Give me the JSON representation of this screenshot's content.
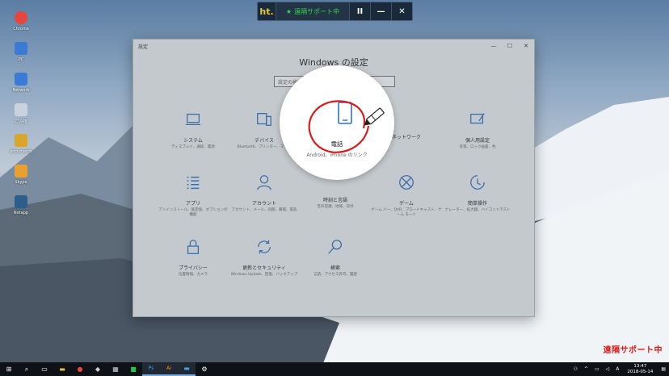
{
  "desktop": {
    "icons": [
      {
        "label": "Chrome",
        "icon": "chrome-icon",
        "color": "#e8453c"
      },
      {
        "label": "PC",
        "icon": "pc-icon",
        "color": "#3a7bd5"
      },
      {
        "label": "Network",
        "icon": "network-icon",
        "color": "#3a7bd5"
      },
      {
        "label": "ごみ箱",
        "icon": "recycle-bin-icon",
        "color": "#c9d3dd"
      },
      {
        "label": "documents",
        "icon": "folder-icon",
        "color": "#d9a52b"
      },
      {
        "label": "Skype",
        "icon": "app-icon",
        "color": "#e8a030"
      },
      {
        "label": "Netapp",
        "icon": "app-icon",
        "color": "#2a5f8c"
      }
    ]
  },
  "remote_bar": {
    "logo": "ht.",
    "status": "遠隔サポート中",
    "pause": "II",
    "minimize": "—",
    "close": "✕"
  },
  "window": {
    "title": "設定",
    "heading": "Windows の設定",
    "search_placeholder": "設定の検索",
    "minimize": "—",
    "maximize": "☐",
    "close": "✕",
    "items": [
      {
        "title": "システム",
        "desc": "ディスプレイ、通知、電源",
        "icon": "laptop-icon"
      },
      {
        "title": "デバイス",
        "desc": "Bluetooth、プリンター、マウス",
        "icon": "devices-icon"
      },
      {
        "title": "",
        "desc": "",
        "icon": ""
      },
      {
        "title": "ネットワーク",
        "desc": "",
        "icon": ""
      },
      {
        "title": "個人用設定",
        "desc": "背景、ロック画面、色",
        "icon": "personalize-icon"
      },
      {
        "title": "アプリ",
        "desc": "アンインストール、既定値、オプションの機能",
        "icon": "apps-icon"
      },
      {
        "title": "アカウント",
        "desc": "アカウント、メール、同期、職場、家族",
        "icon": "account-icon"
      },
      {
        "title": "時刻と言語",
        "desc": "音声認識、地域、日付",
        "icon": "time-icon"
      },
      {
        "title": "ゲーム",
        "desc": "ゲーム バー、DVR、ブロードキャスト、ゲーム モード",
        "icon": "xbox-icon"
      },
      {
        "title": "簡単操作",
        "desc": "ナレーター、拡大鏡、ハイコントラスト",
        "icon": "ease-icon"
      },
      {
        "title": "プライバシー",
        "desc": "位置情報、カメラ",
        "icon": "lock-icon"
      },
      {
        "title": "更新とセキュリティ",
        "desc": "Windows Update、回復、バックアップ",
        "icon": "sync-icon"
      },
      {
        "title": "検索",
        "desc": "言語、アクセス許可、履歴",
        "icon": "search-icon"
      }
    ]
  },
  "magnifier": {
    "title": "電話",
    "desc": "Android、iPhone のリンク",
    "icon": "phone-icon"
  },
  "taskbar": {
    "items": [
      "start-icon",
      "search-icon",
      "task-view-icon",
      "file-explorer-icon",
      "chrome-icon",
      "paint-icon",
      "calculator-icon",
      "line-icon",
      "photoshop-icon",
      "illustrator-icon",
      "app-icon",
      "settings-icon"
    ],
    "tray_a": "A",
    "clock_time": "13:47",
    "clock_date": "2018-05-14"
  },
  "watermark": "遠隔サポート中"
}
